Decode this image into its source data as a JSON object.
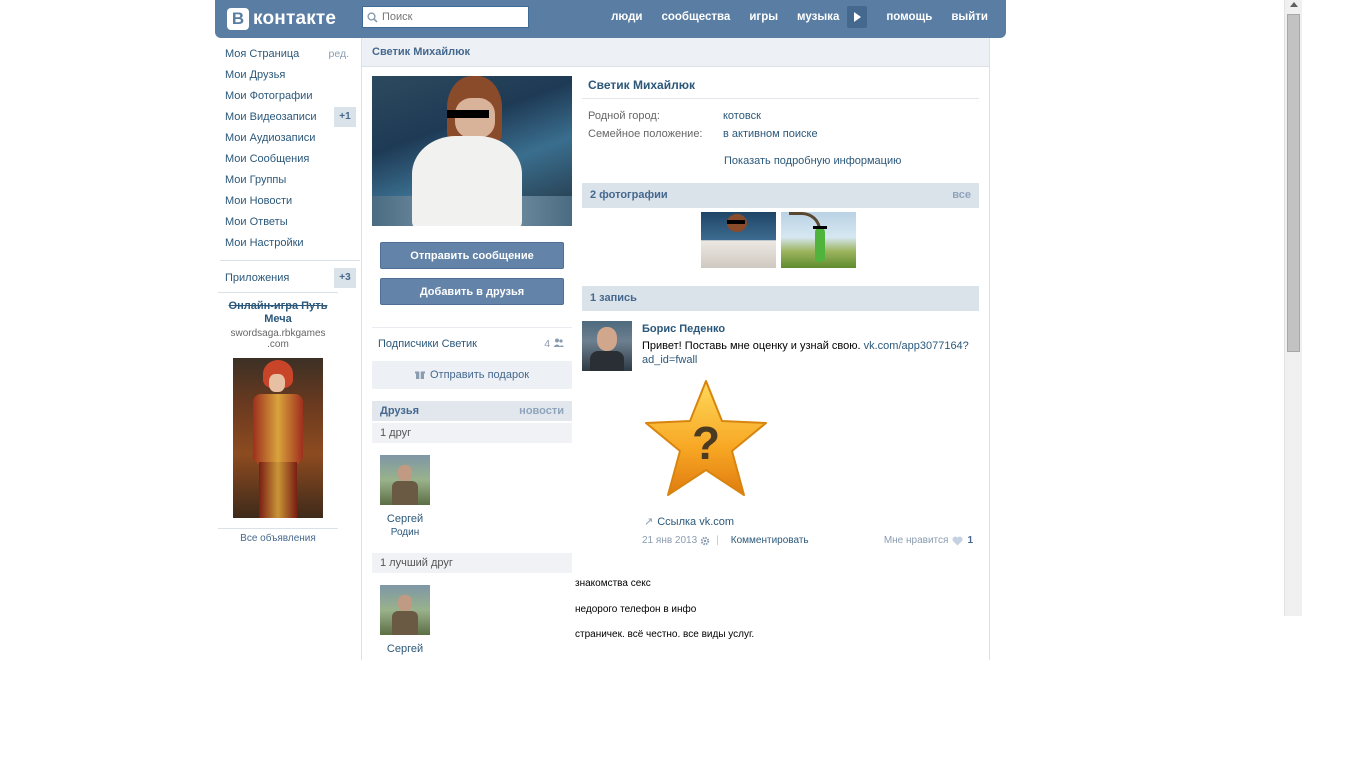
{
  "header": {
    "logo_letter": "В",
    "logo_text": "контакте",
    "search_placeholder": "Поиск",
    "nav": [
      "люди",
      "сообщества",
      "игры",
      "музыка",
      "помощь",
      "выйти"
    ]
  },
  "sidebar": {
    "items": [
      {
        "label": "Моя Страница",
        "extra": "ред."
      },
      {
        "label": "Мои Друзья"
      },
      {
        "label": "Мои Фотографии"
      },
      {
        "label": "Мои Видеозаписи",
        "badge": "+1"
      },
      {
        "label": "Мои Аудиозаписи"
      },
      {
        "label": "Мои Сообщения"
      },
      {
        "label": "Мои Группы"
      },
      {
        "label": "Мои Новости"
      },
      {
        "label": "Мои Ответы"
      },
      {
        "label": "Мои Настройки"
      }
    ],
    "apps": {
      "label": "Приложения",
      "badge": "+3"
    }
  },
  "ad": {
    "title_strike": "Онлайн-игра Путь",
    "title_rest": "Меча",
    "url_line1": "swordsaga.rbkgames",
    "url_line2": ".com",
    "all_ads": "Все объявления"
  },
  "profile": {
    "header_name": "Светик Михайлюк",
    "name": "Светик Михайлюк",
    "info": [
      {
        "label": "Родной город:",
        "value": "котовск"
      },
      {
        "label": "Семейное положение:",
        "value": "в активном поиске"
      }
    ],
    "more_info": "Показать подробную информацию",
    "send_message": "Отправить сообщение",
    "add_friend": "Добавить в друзья",
    "subscribers_label": "Подписчики Светик",
    "subscribers_count": "4",
    "gift": "Отправить подарок",
    "friends_title": "Друзья",
    "friends_news": "новости",
    "friends_count": "1 друг",
    "friend1_first": "Сергей",
    "friend1_last": "Родин",
    "best_friends_count": "1 лучший друг",
    "friend2_first": "Сергей",
    "photos_title": "2 фотографии",
    "photos_all": "все",
    "posts_title": "1 запись"
  },
  "post": {
    "author": "Борис Педенко",
    "text": "Привет! Поставь мне оценку и узнай свою. ",
    "link": "vk.com/app3077164?ad_id=fwall",
    "attachment": "Ссылка vk.com",
    "date": "21 янв 2013",
    "comment": "Комментировать",
    "like_label": "Мне нравится",
    "like_count": "1"
  },
  "spam_lines": [
    "знакомства секс",
    "недорого телефон в инфо",
    "страничек. всё честно. все виды услуг."
  ]
}
